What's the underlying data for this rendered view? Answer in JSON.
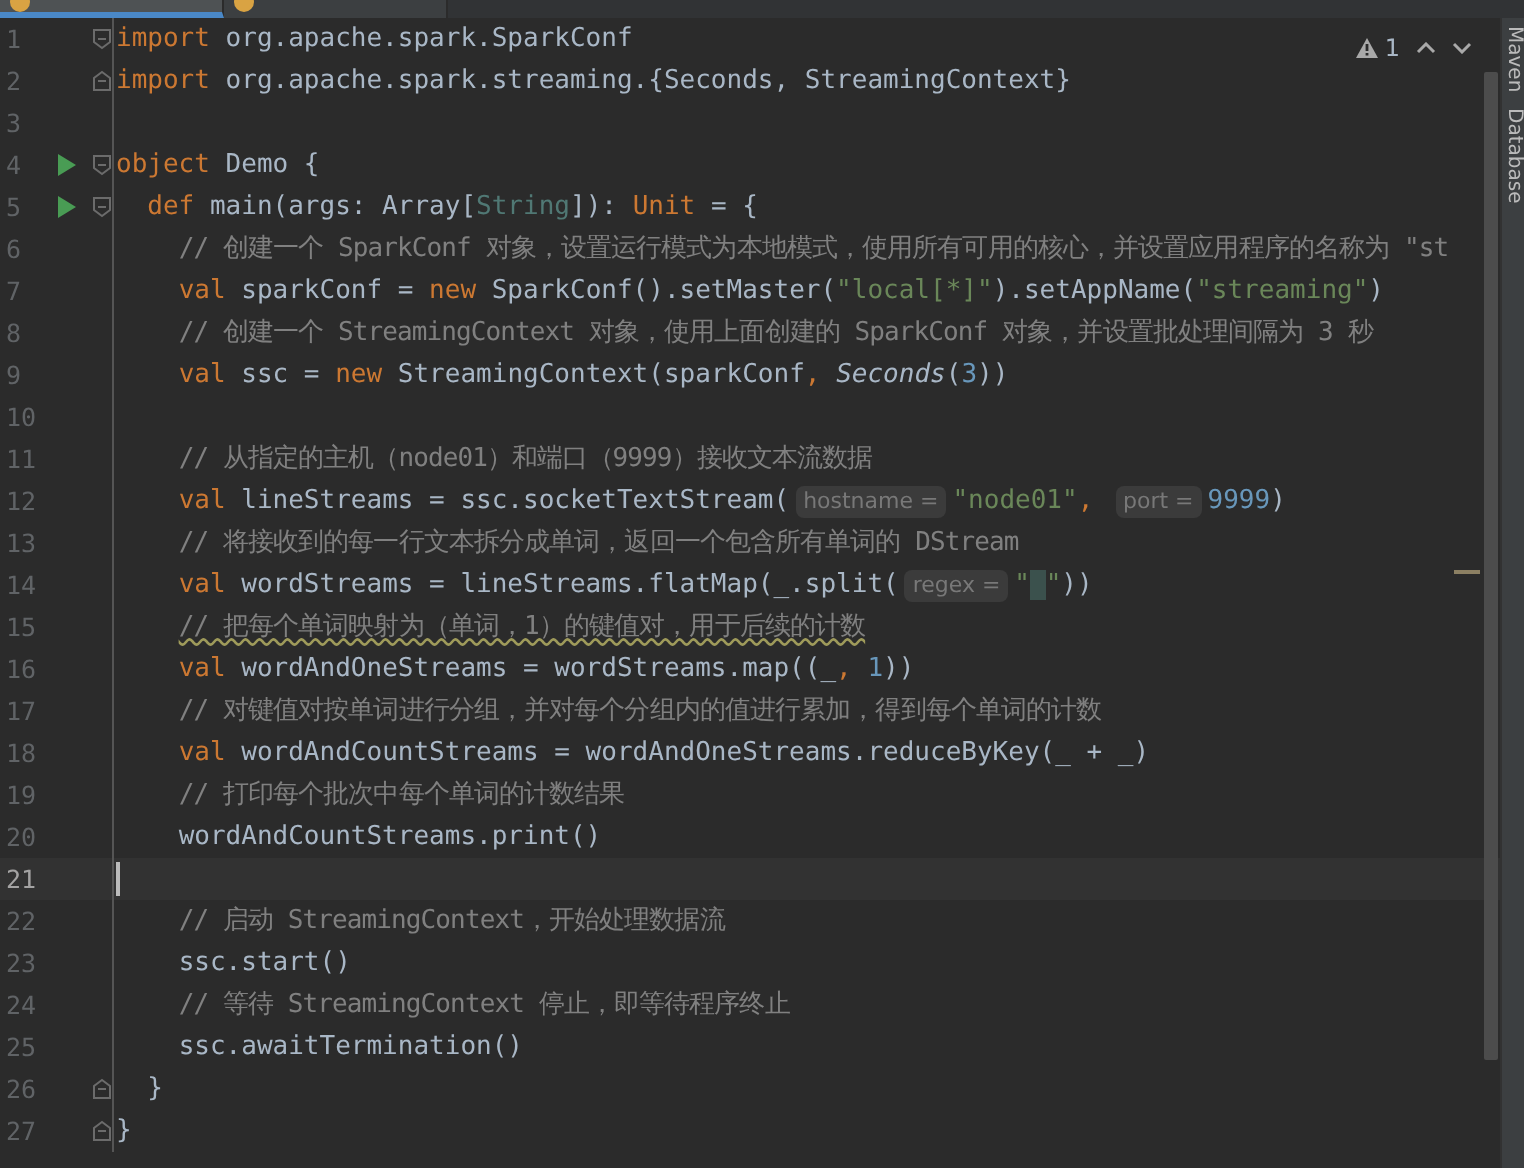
{
  "editor_tabs": [
    {
      "selected": true
    },
    {
      "selected": false
    }
  ],
  "inspection": {
    "count": "1"
  },
  "side_panels": [
    {
      "label": "Maven"
    },
    {
      "label": "Database"
    }
  ],
  "lines": [
    {
      "n": "1",
      "run": false,
      "fold_start": true,
      "fold_end": false,
      "current": false,
      "tokens": [
        {
          "kind": "keyword",
          "text": "import"
        },
        {
          "kind": "plain",
          "text": " org.apache.spark.SparkConf"
        }
      ]
    },
    {
      "n": "2",
      "run": false,
      "fold_start": false,
      "fold_end": true,
      "current": false,
      "tokens": [
        {
          "kind": "keyword",
          "text": "import"
        },
        {
          "kind": "plain",
          "text": " org.apache.spark.streaming.{Seconds, StreamingContext}"
        }
      ]
    },
    {
      "n": "3",
      "run": false,
      "fold_start": false,
      "fold_end": false,
      "current": false
    },
    {
      "n": "4",
      "run": true,
      "fold_start": true,
      "fold_end": false,
      "current": false,
      "tokens": [
        {
          "kind": "keyword",
          "text": "object"
        },
        {
          "kind": "plain",
          "text": " Demo {"
        }
      ],
      "children": [
        {
          "n": "5",
          "run": true,
          "fold_start": true,
          "fold_end": false,
          "current": false,
          "tokens": [
            {
              "kind": "keyword",
              "text": "def"
            },
            {
              "kind": "plain",
              "text": " main(args: Array["
            },
            {
              "kind": "type",
              "text": "String"
            },
            {
              "kind": "plain",
              "text": "]): "
            },
            {
              "kind": "keyword",
              "text": "Unit"
            },
            {
              "kind": "plain",
              "text": " = {"
            }
          ],
          "children": [
            {
              "n": "6",
              "run": false,
              "fold_start": false,
              "fold_end": false,
              "current": false,
              "tokens": [
                {
                  "kind": "comment",
                  "text": "// 创建一个 SparkConf 对象，设置运行模式为本地模式，使用所有可用的核心，并设置应用程序的名称为 \"st"
                }
              ]
            },
            {
              "n": "7",
              "run": false,
              "fold_start": false,
              "fold_end": false,
              "current": false,
              "tokens": [
                {
                  "kind": "keyword",
                  "text": "val"
                },
                {
                  "kind": "plain",
                  "text": " sparkConf = "
                },
                {
                  "kind": "keyword",
                  "text": "new"
                },
                {
                  "kind": "plain",
                  "text": " SparkConf().setMaster("
                },
                {
                  "kind": "string",
                  "text": "\"local[*]\""
                },
                {
                  "kind": "plain",
                  "text": ").setAppName("
                },
                {
                  "kind": "string",
                  "text": "\"streaming\""
                },
                {
                  "kind": "plain",
                  "text": ")"
                }
              ]
            },
            {
              "n": "8",
              "run": false,
              "fold_start": false,
              "fold_end": false,
              "current": false,
              "tokens": [
                {
                  "kind": "comment",
                  "text": "// 创建一个 StreamingContext 对象，使用上面创建的 SparkConf 对象，并设置批处理间隔为 3 秒"
                }
              ]
            },
            {
              "n": "9",
              "run": false,
              "fold_start": false,
              "fold_end": false,
              "current": false,
              "tokens": [
                {
                  "kind": "keyword",
                  "text": "val"
                },
                {
                  "kind": "plain",
                  "text": " ssc = "
                },
                {
                  "kind": "keyword",
                  "text": "new"
                },
                {
                  "kind": "plain",
                  "text": " StreamingContext(sparkConf"
                },
                {
                  "kind": "keyword",
                  "text": ", "
                },
                {
                  "kind": "italic",
                  "text": "Seconds"
                },
                {
                  "kind": "plain",
                  "text": "("
                },
                {
                  "kind": "number",
                  "text": "3"
                },
                {
                  "kind": "plain",
                  "text": "))"
                }
              ]
            },
            {
              "n": "10",
              "run": false,
              "fold_start": false,
              "fold_end": false,
              "current": false
            },
            {
              "n": "11",
              "run": false,
              "fold_start": false,
              "fold_end": false,
              "current": false,
              "tokens": [
                {
                  "kind": "comment",
                  "text": "// 从指定的主机（node01）和端口（9999）接收文本流数据"
                }
              ]
            },
            {
              "n": "12",
              "run": false,
              "fold_start": false,
              "fold_end": false,
              "current": false,
              "tokens": [
                {
                  "kind": "keyword",
                  "text": "val"
                },
                {
                  "kind": "plain",
                  "text": " lineStreams = ssc.socketTextStream("
                },
                {
                  "kind": "hint",
                  "text": "hostname ="
                },
                {
                  "kind": "string",
                  "text": "\"node01\""
                },
                {
                  "kind": "keyword",
                  "text": ", "
                },
                {
                  "kind": "hint",
                  "text": "port ="
                },
                {
                  "kind": "number",
                  "text": "9999"
                },
                {
                  "kind": "plain",
                  "text": ")"
                }
              ]
            },
            {
              "n": "13",
              "run": false,
              "fold_start": false,
              "fold_end": false,
              "current": false,
              "tokens": [
                {
                  "kind": "comment",
                  "text": "// 将接收到的每一行文本拆分成单词，返回一个包含所有单词的 DStream"
                }
              ]
            },
            {
              "n": "14",
              "run": false,
              "fold_start": false,
              "fold_end": false,
              "current": false,
              "tokens": [
                {
                  "kind": "keyword",
                  "text": "val"
                },
                {
                  "kind": "plain",
                  "text": " wordStreams = lineStreams.flatMap(_.split("
                },
                {
                  "kind": "hint",
                  "text": "regex ="
                },
                {
                  "kind": "quoted-space",
                  "text": "\" \""
                },
                {
                  "kind": "plain",
                  "text": "))"
                }
              ]
            },
            {
              "n": "15",
              "run": false,
              "fold_start": false,
              "fold_end": false,
              "current": false,
              "tokens": [
                {
                  "kind": "comment-typo",
                  "text": "// 把每个单词映射为（单词，1）的键值对，用于后续的计数"
                }
              ]
            },
            {
              "n": "16",
              "run": false,
              "fold_start": false,
              "fold_end": false,
              "current": false,
              "tokens": [
                {
                  "kind": "keyword",
                  "text": "val"
                },
                {
                  "kind": "plain",
                  "text": " wordAndOneStreams = wordStreams.map((_"
                },
                {
                  "kind": "keyword",
                  "text": ", "
                },
                {
                  "kind": "number",
                  "text": "1"
                },
                {
                  "kind": "plain",
                  "text": "))"
                }
              ]
            },
            {
              "n": "17",
              "run": false,
              "fold_start": false,
              "fold_end": false,
              "current": false,
              "tokens": [
                {
                  "kind": "comment",
                  "text": "// 对键值对按单词进行分组，并对每个分组内的值进行累加，得到每个单词的计数"
                }
              ]
            },
            {
              "n": "18",
              "run": false,
              "fold_start": false,
              "fold_end": false,
              "current": false,
              "tokens": [
                {
                  "kind": "keyword",
                  "text": "val"
                },
                {
                  "kind": "plain",
                  "text": " wordAndCountStreams = wordAndOneStreams.reduceByKey(_ + _)"
                }
              ]
            },
            {
              "n": "19",
              "run": false,
              "fold_start": false,
              "fold_end": false,
              "current": false,
              "tokens": [
                {
                  "kind": "comment",
                  "text": "// 打印每个批次中每个单词的计数结果"
                }
              ]
            },
            {
              "n": "20",
              "run": false,
              "fold_start": false,
              "fold_end": false,
              "current": false,
              "tokens": [
                {
                  "kind": "plain",
                  "text": "wordAndCountStreams.print()"
                }
              ]
            },
            {
              "n": "21",
              "run": false,
              "fold_start": false,
              "fold_end": false,
              "current": true
            },
            {
              "n": "22",
              "run": false,
              "fold_start": false,
              "fold_end": false,
              "current": false,
              "tokens": [
                {
                  "kind": "comment",
                  "text": "// 启动 StreamingContext，开始处理数据流"
                }
              ]
            },
            {
              "n": "23",
              "run": false,
              "fold_start": false,
              "fold_end": false,
              "current": false,
              "tokens": [
                {
                  "kind": "plain",
                  "text": "ssc.start()"
                }
              ]
            },
            {
              "n": "24",
              "run": false,
              "fold_start": false,
              "fold_end": false,
              "current": false,
              "tokens": [
                {
                  "kind": "comment",
                  "text": "// 等待 StreamingContext 停止，即等待程序终止"
                }
              ]
            },
            {
              "n": "25",
              "run": false,
              "fold_start": false,
              "fold_end": false,
              "current": false,
              "tokens": [
                {
                  "kind": "plain",
                  "text": "ssc.awaitTermination()"
                }
              ]
            }
          ]
        },
        {
          "n": "26",
          "run": false,
          "fold_start": false,
          "fold_end": true,
          "current": false,
          "tokens": [
            {
              "kind": "plain",
              "text": "}"
            }
          ]
        }
      ]
    },
    {
      "n": "27",
      "run": false,
      "fold_start": false,
      "fold_end": true,
      "current": false,
      "tokens": [
        {
          "kind": "plain",
          "text": "}"
        }
      ]
    }
  ]
}
